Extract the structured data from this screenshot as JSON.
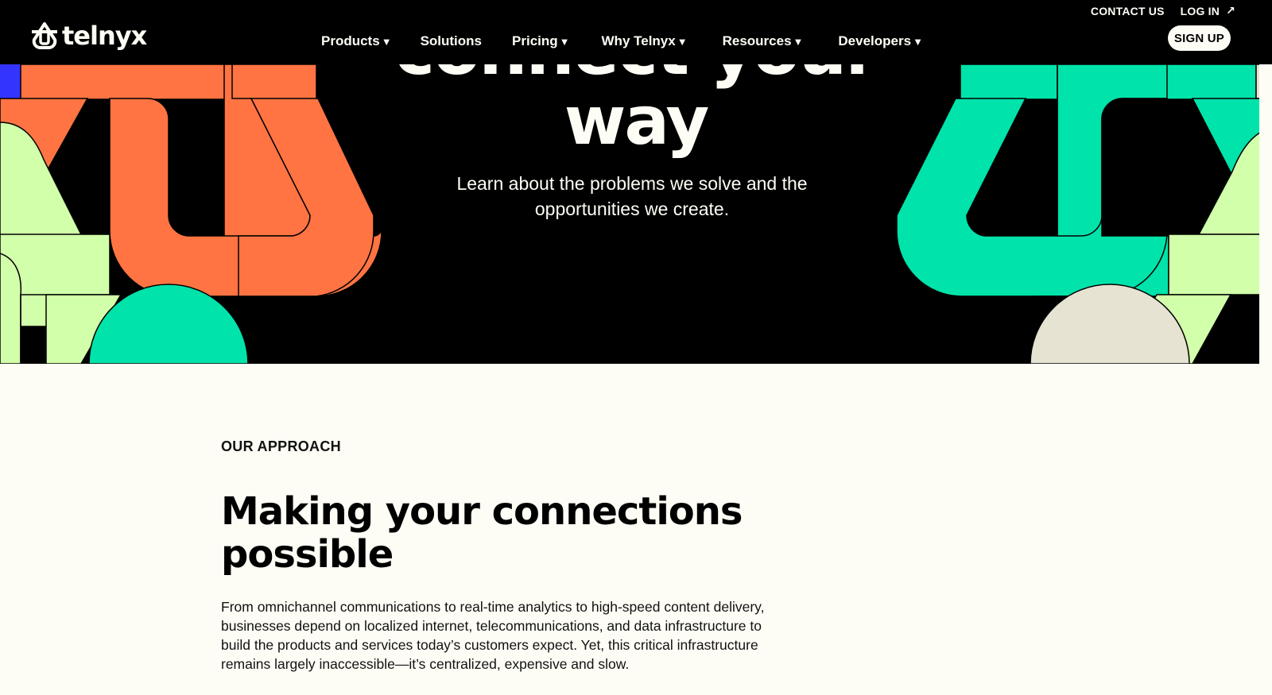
{
  "header": {
    "brand": "telnyx",
    "top_links": {
      "contact": "CONTACT US",
      "login": "LOG IN"
    },
    "nav": [
      "Products",
      "Solutions",
      "Pricing",
      "Why Telnyx",
      "Resources",
      "Developers"
    ],
    "signup": "SIGN UP"
  },
  "hero": {
    "title_cut": "connect your",
    "title": "way",
    "subtitle": "Learn about the problems we solve and the opportunities we create."
  },
  "approach": {
    "eyebrow": "OUR APPROACH",
    "title": "Making your connections possible",
    "body": "From omnichannel communications to real-time analytics to high-speed content delivery, businesses depend on localized internet, telecommunications, and data infrastructure to build the products and services today’s customers expect. Yet, this critical infrastructure remains largely inaccessible—it’s centralized, expensive and slow."
  },
  "colors": {
    "orange": "#FF7442",
    "green": "#00E3AA",
    "lime": "#D2FFAA",
    "sand": "#E6E3D3",
    "blue": "#3434FF",
    "cream": "#FEFDF5",
    "black": "#000000"
  }
}
